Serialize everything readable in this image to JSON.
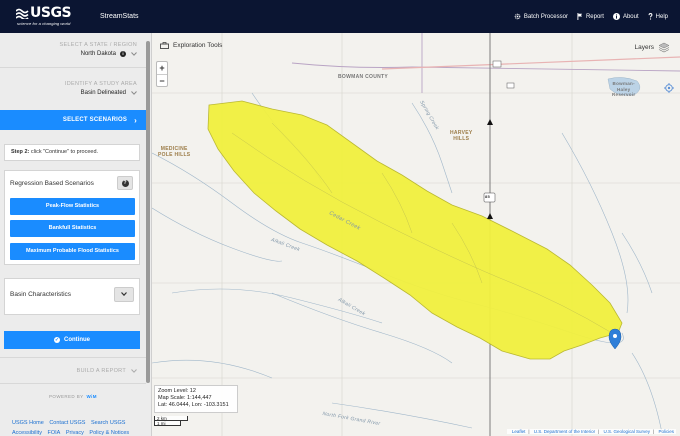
{
  "header": {
    "logo_text": "USGS",
    "logo_tagline": "science for a changing world",
    "app_title": "StreamStats",
    "nav": [
      {
        "label": "Batch Processor",
        "icon": "cog-icon"
      },
      {
        "label": "Report",
        "icon": "flag-icon"
      },
      {
        "label": "About",
        "icon": "info-icon"
      },
      {
        "label": "Help",
        "icon": "question-icon"
      }
    ]
  },
  "sidebar": {
    "state_section": {
      "heading": "SELECT A STATE / REGION",
      "value": "North Dakota"
    },
    "study_section": {
      "heading": "IDENTIFY A STUDY AREA",
      "value": "Basin Delineated"
    },
    "scenarios_label": "SELECT SCENARIOS",
    "step_prefix": "Step 2:",
    "step_text": " click \"Continue\" to proceed.",
    "regression": {
      "heading": "Regression Based Scenarios",
      "help": "?",
      "buttons": [
        "Peak-Flow Statistics",
        "Bankfull Statistics",
        "Maximum Probable Flood Statistics"
      ]
    },
    "basin_characteristics": "Basin Characteristics",
    "continue_label": "Continue",
    "build_section": {
      "heading": "BUILD A REPORT"
    },
    "powered_by": "POWERED BY",
    "powered_brand": "WiM",
    "footer_links": [
      "USGS Home",
      "Contact USGS",
      "Search USGS",
      "Accessibility",
      "FOIA",
      "Privacy",
      "Policy & Notices"
    ]
  },
  "map": {
    "exploration_tools": "Exploration Tools",
    "layers": "Layers",
    "zoom_in": "+",
    "zoom_out": "−",
    "zoom_level": "Zoom Level: 12",
    "map_scale": "Map Scale: 1:144,447",
    "lat_lon": "Lat: 46.0444, Lon: -103.3151",
    "scale_km": "2 km",
    "scale_mi": "1 mi",
    "attribution": [
      "Leaflet",
      "U.S. Department of the Interior",
      "U.S. Geological Survey",
      "Policies"
    ],
    "labels": {
      "bowman": "BOWMAN COUNTY",
      "harvey": "HARVEY\nHILLS",
      "medicine": "MEDICINE\nPOLE HILLS",
      "bowman_reservoir": "Bowman-\nHaley\nReservoir",
      "cedar_creek": "Cedar Creek",
      "alkali_creek": "Alkali Creek",
      "alkali_creek_2": "Alkali Creek",
      "spring_creek": "Spring Creek",
      "north_fork": "North Fork Grand River",
      "route_85": "85"
    },
    "watershed_color": "#f1f03f",
    "watershed_outline": "#b8b62a",
    "marker_color": "#2f7fd8"
  }
}
